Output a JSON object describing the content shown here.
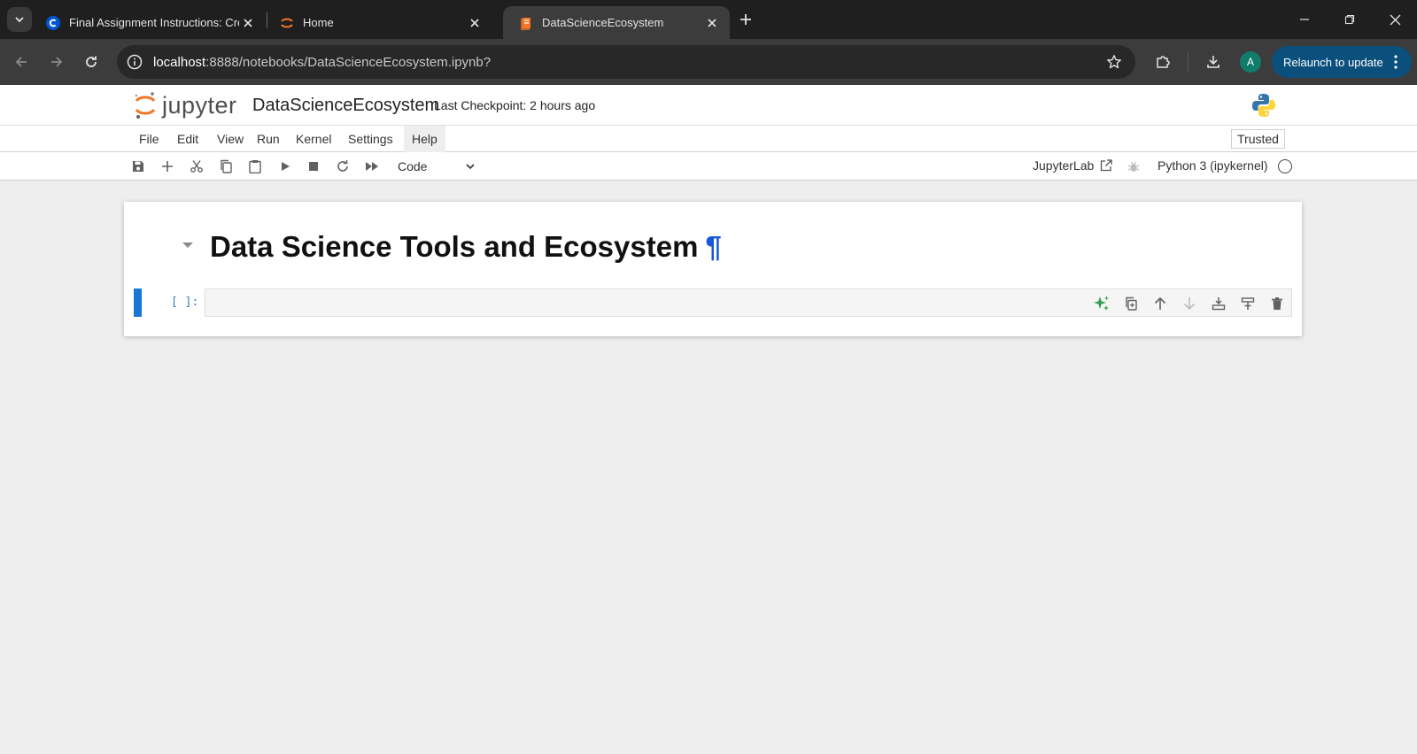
{
  "browser": {
    "tabs": [
      {
        "title": "Final Assignment Instructions: Crea",
        "active": false
      },
      {
        "title": "Home",
        "active": false
      },
      {
        "title": "DataScienceEcosystem",
        "active": true
      }
    ],
    "url": {
      "host": "localhost",
      "rest": ":8888/notebooks/DataScienceEcosystem.ipynb?"
    },
    "avatar_letter": "A",
    "relaunch_label": "Relaunch to update",
    "colors": {
      "tabstrip": "#1f1f1f",
      "toolbar": "#3c3c3c",
      "relaunch": "#0b4f7c",
      "avatar": "#0f7d6a"
    }
  },
  "jupyter": {
    "logo_text": "jupyter",
    "notebook_title": "DataScienceEcosystem",
    "checkpoint": "Last Checkpoint: 2 hours ago",
    "menu": [
      "File",
      "Edit",
      "View",
      "Run",
      "Kernel",
      "Settings",
      "Help"
    ],
    "trusted_label": "Trusted",
    "cell_type": "Code",
    "jupyterlab_link": "JupyterLab",
    "kernel_name": "Python 3 (ipykernel)",
    "toolbar_icons": [
      "save-icon",
      "plus-icon",
      "cut-icon",
      "copy-icon",
      "paste-icon",
      "run-icon",
      "stop-icon",
      "restart-icon",
      "fast-forward-icon"
    ],
    "colors": {
      "accent": "#1976d2",
      "prompt": "#307fc1",
      "anchor": "#1a56db",
      "logo_orange": "#f37726"
    }
  },
  "notebook": {
    "heading": "Data Science Tools and Ecosystem",
    "anchor_symbol": "¶",
    "code_prompt": "[ ]:",
    "cell_toolbar": [
      "sparkle-ai-icon",
      "duplicate-icon",
      "move-up-icon",
      "move-down-icon",
      "insert-below-icon",
      "split-cell-icon",
      "delete-icon"
    ]
  }
}
